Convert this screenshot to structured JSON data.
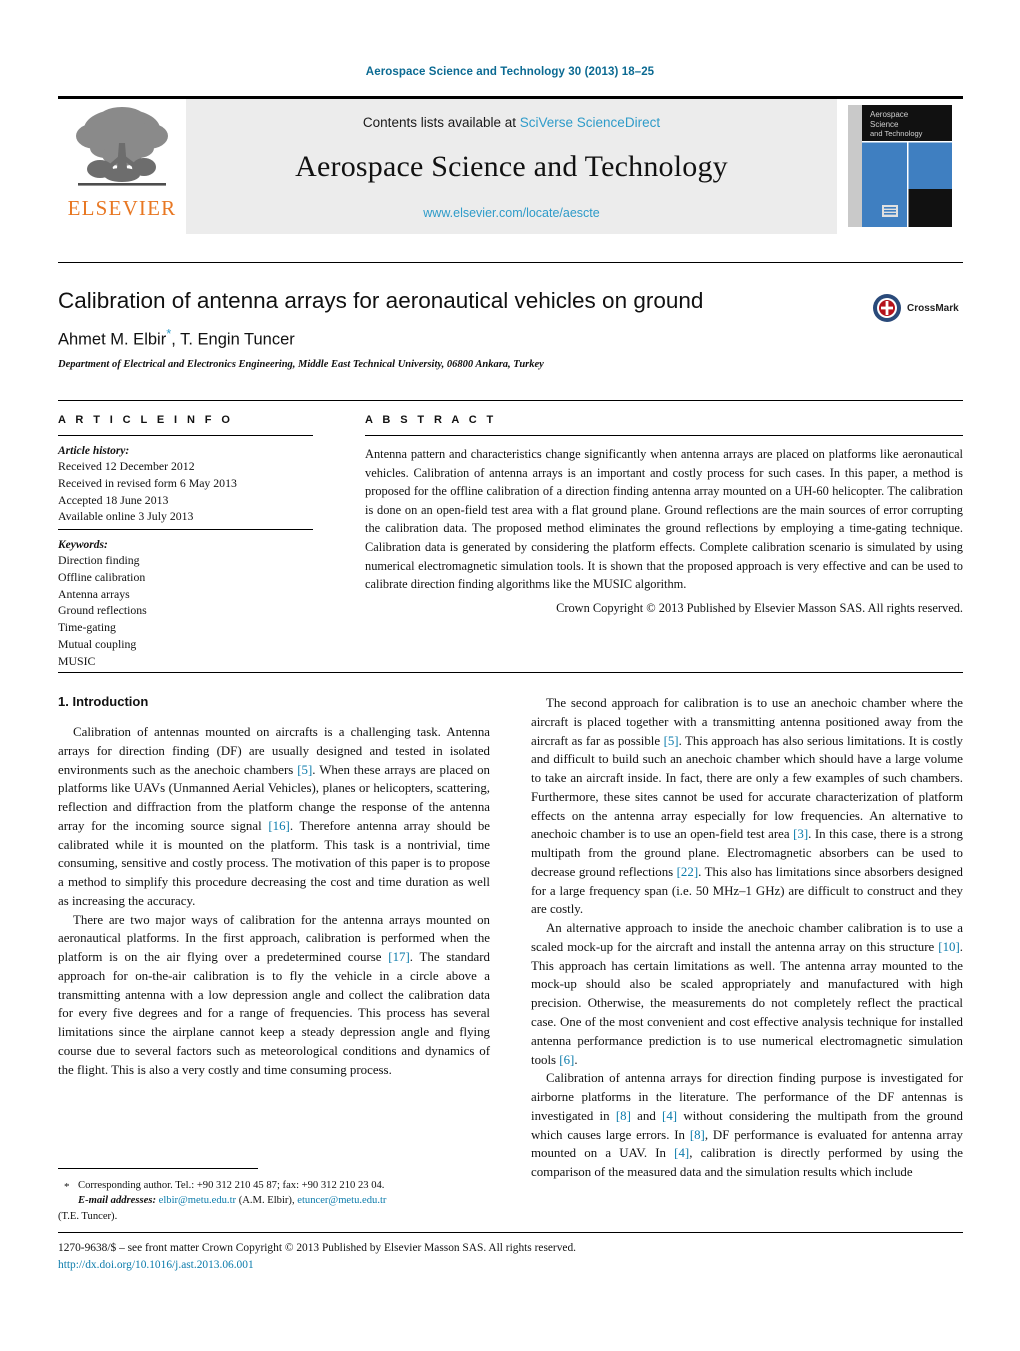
{
  "running_head": "Aerospace Science and Technology 30 (2013) 18–25",
  "masthead": {
    "contents_prefix": "Contents lists available at ",
    "contents_link": "SciVerse ScienceDirect",
    "journal_title": "Aerospace Science and Technology",
    "journal_url": "www.elsevier.com/locate/aescte",
    "publisher_logo_text": "ELSEVIER",
    "cover_title_line1": "Aerospace",
    "cover_title_line2": "Science",
    "cover_title_line3": "and",
    "cover_title_line4": "Technology"
  },
  "article": {
    "title": "Calibration of antenna arrays for aeronautical vehicles on ground",
    "authors_part1": "Ahmet M. Elbir",
    "authors_star": "*",
    "authors_part2": ", T. Engin Tuncer",
    "affiliation": "Department of Electrical and Electronics Engineering, Middle East Technical University, 06800 Ankara, Turkey",
    "crossmark_label": "CrossMark"
  },
  "article_info": {
    "heading": "A R T I C L E    I N F O",
    "history_label": "Article history:",
    "history": [
      "Received 12 December 2012",
      "Received in revised form 6 May 2013",
      "Accepted 18 June 2013",
      "Available online 3 July 2013"
    ],
    "keywords_label": "Keywords:",
    "keywords": [
      "Direction finding",
      "Offline calibration",
      "Antenna arrays",
      "Ground reflections",
      "Time-gating",
      "Mutual coupling",
      "MUSIC"
    ]
  },
  "abstract": {
    "heading": "A B S T R A C T",
    "text": "Antenna pattern and characteristics change significantly when antenna arrays are placed on platforms like aeronautical vehicles. Calibration of antenna arrays is an important and costly process for such cases. In this paper, a method is proposed for the offline calibration of a direction finding antenna array mounted on a UH-60 helicopter. The calibration is done on an open-field test area with a flat ground plane. Ground reflections are the main sources of error corrupting the calibration data. The proposed method eliminates the ground reflections by employing a time-gating technique. Calibration data is generated by considering the platform effects. Complete calibration scenario is simulated by using numerical electromagnetic simulation tools. It is shown that the proposed approach is very effective and can be used to calibrate direction finding algorithms like the MUSIC algorithm.",
    "copyright": "Crown Copyright © 2013 Published by Elsevier Masson SAS. All rights reserved."
  },
  "body": {
    "section_title": "1. Introduction",
    "left_paragraphs": [
      {
        "parts": [
          {
            "t": "Calibration of antennas mounted on aircrafts is a challenging task. Antenna arrays for direction finding (DF) are usually designed and tested in isolated environments such as the anechoic chambers "
          },
          {
            "t": "[5]",
            "ref": true
          },
          {
            "t": ". When these arrays are placed on platforms like UAVs (Unmanned Aerial Vehicles), planes or helicopters, scattering, reflection and diffraction from the platform change the response of the antenna array for the incoming source signal "
          },
          {
            "t": "[16]",
            "ref": true
          },
          {
            "t": ". Therefore antenna array should be calibrated while it is mounted on the platform. This task is a nontrivial, time consuming, sensitive and costly process. The motivation of this paper is to propose a method to simplify this procedure decreasing the cost and time duration as well as increasing the accuracy."
          }
        ]
      },
      {
        "parts": [
          {
            "t": "There are two major ways of calibration for the antenna arrays mounted on aeronautical platforms. In the first approach, calibration is performed when the platform is on the air flying over a predetermined course "
          },
          {
            "t": "[17]",
            "ref": true
          },
          {
            "t": ". The standard approach for on-the-air calibration is to fly the vehicle in a circle above a transmitting antenna with a low depression angle and collect the calibration data for every five degrees and for a range of frequencies. This process has several limitations since the airplane cannot keep a steady depression angle and flying course due to several factors such as meteorological conditions and dynamics of the flight. This is also a very costly and time consuming process."
          }
        ]
      }
    ],
    "right_paragraphs": [
      {
        "parts": [
          {
            "t": "The second approach for calibration is to use an anechoic chamber where the aircraft is placed together with a transmitting antenna positioned away from the aircraft as far as possible "
          },
          {
            "t": "[5]",
            "ref": true
          },
          {
            "t": ". This approach has also serious limitations. It is costly and difficult to build such an anechoic chamber which should have a large volume to take an aircraft inside. In fact, there are only a few examples of such chambers. Furthermore, these sites cannot be used for accurate characterization of platform effects on the antenna array especially for low frequencies. An alternative to anechoic chamber is to use an open-field test area "
          },
          {
            "t": "[3]",
            "ref": true
          },
          {
            "t": ". In this case, there is a strong multipath from the ground plane. Electromagnetic absorbers can be used to decrease ground reflections "
          },
          {
            "t": "[22]",
            "ref": true
          },
          {
            "t": ". This also has limitations since absorbers designed for a large frequency span (i.e. 50 MHz–1 GHz) are difficult to construct and they are costly."
          }
        ]
      },
      {
        "parts": [
          {
            "t": "An alternative approach to inside the anechoic chamber calibration is to use a scaled mock-up for the aircraft and install the antenna array on this structure "
          },
          {
            "t": "[10]",
            "ref": true
          },
          {
            "t": ". This approach has certain limitations as well. The antenna array mounted to the mock-up should also be scaled appropriately and manufactured with high precision. Otherwise, the measurements do not completely reflect the practical case. One of the most convenient and cost effective analysis technique for installed antenna performance prediction is to use numerical electromagnetic simulation tools "
          },
          {
            "t": "[6]",
            "ref": true
          },
          {
            "t": "."
          }
        ]
      },
      {
        "parts": [
          {
            "t": "Calibration of antenna arrays for direction finding purpose is investigated for airborne platforms in the literature. The performance of the DF antennas is investigated in "
          },
          {
            "t": "[8]",
            "ref": true
          },
          {
            "t": " and "
          },
          {
            "t": "[4]",
            "ref": true
          },
          {
            "t": " without considering the multipath from the ground which causes large errors. In "
          },
          {
            "t": "[8]",
            "ref": true
          },
          {
            "t": ", DF performance is evaluated for antenna array mounted on a UAV. In "
          },
          {
            "t": "[4]",
            "ref": true
          },
          {
            "t": ", calibration is directly performed by using the comparison of the measured data and the simulation results which include"
          }
        ]
      }
    ]
  },
  "footnote": {
    "corresponding": "Corresponding author. Tel.: +90 312 210 45 87; fax: +90 312 210 23 04.",
    "email_label": "E-mail addresses:",
    "email1": "elbir@metu.edu.tr",
    "email1_owner": " (A.M. Elbir), ",
    "email2": "etuncer@metu.edu.tr",
    "email2_owner": "(T.E. Tuncer)."
  },
  "footer": {
    "issn_line": "1270-9638/$ – see front matter Crown Copyright © 2013 Published by Elsevier Masson SAS. All rights reserved.",
    "doi": "http://dx.doi.org/10.1016/j.ast.2013.06.001"
  },
  "colors": {
    "link_blue": "#2e9bc9",
    "ref_blue": "#0b7bab",
    "head_blue": "#0b6a92",
    "elsevier_orange": "#e87722",
    "cover_blue": "#3f7fc1"
  }
}
